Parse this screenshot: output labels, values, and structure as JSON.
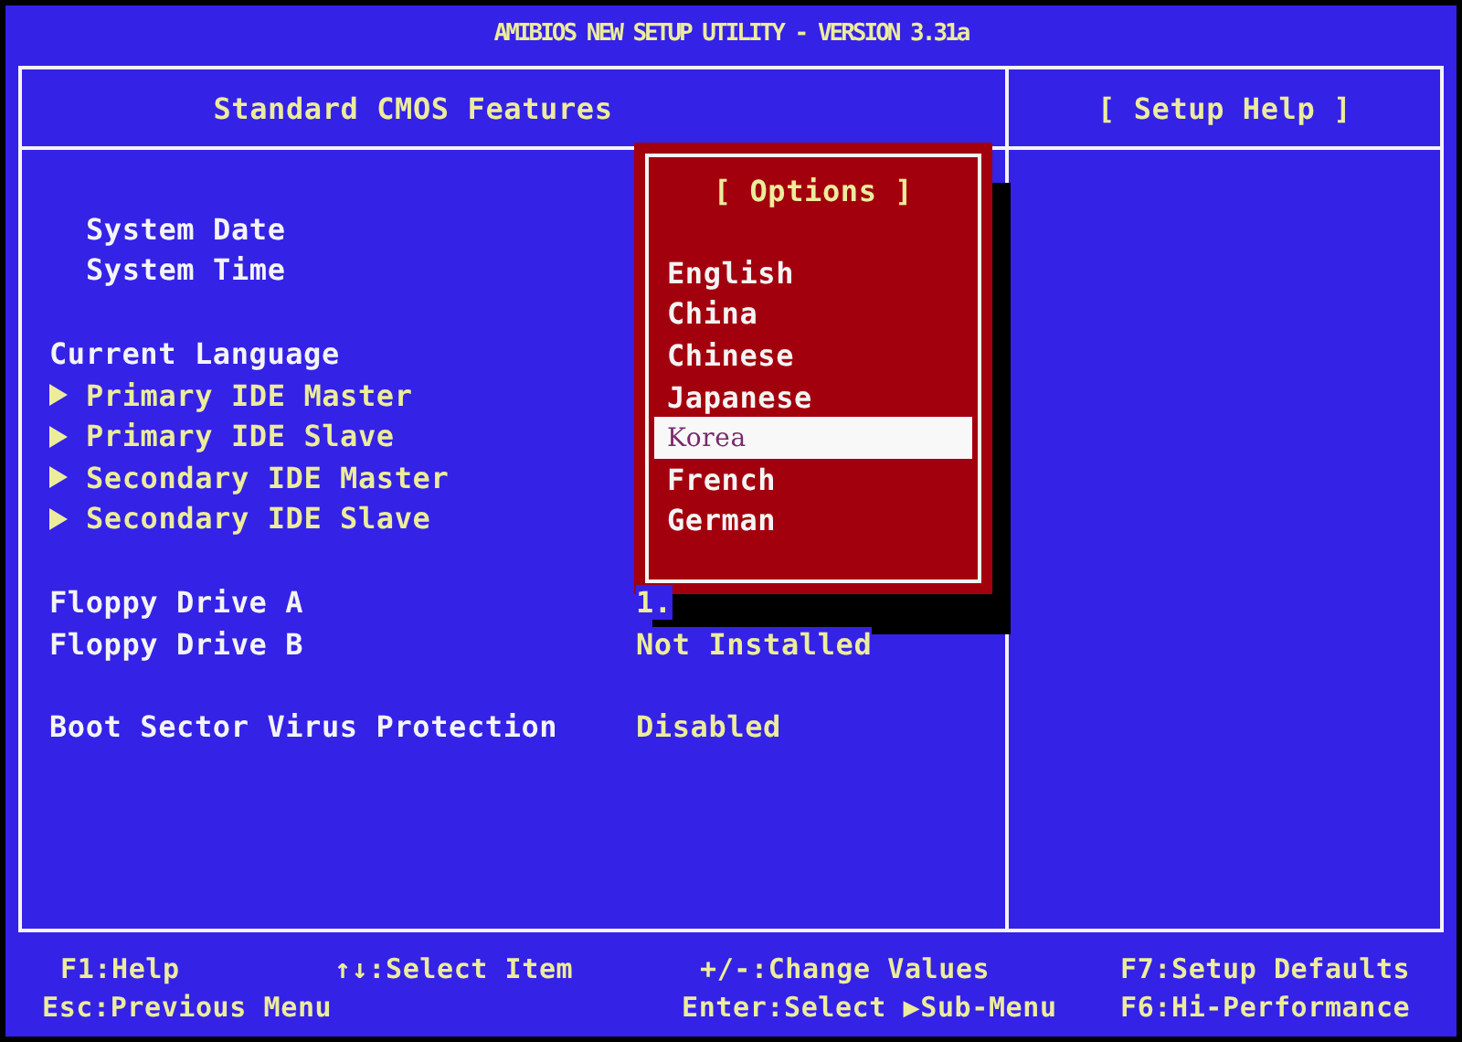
{
  "window": {
    "title": "AMIBIOS NEW SETUP UTILITY - VERSION 3.31a"
  },
  "header": {
    "section": "Standard CMOS Features",
    "help": "[ Setup Help ]"
  },
  "groups": [
    [
      {
        "label": "System Date",
        "kind": "indented"
      },
      {
        "label": "System Time",
        "kind": "indented"
      }
    ],
    [
      {
        "label": "Current Language",
        "kind": "plain"
      },
      {
        "label": "Primary IDE Master",
        "kind": "submenu"
      },
      {
        "label": "Primary IDE Slave",
        "kind": "submenu"
      },
      {
        "label": "Secondary IDE Master",
        "kind": "submenu"
      },
      {
        "label": "Secondary IDE Slave",
        "kind": "submenu"
      }
    ],
    [
      {
        "label": "Floppy Drive A",
        "kind": "plain",
        "value": "1."
      },
      {
        "label": "Floppy Drive B",
        "kind": "plain",
        "value": "Not Installed"
      }
    ],
    [
      {
        "label": "Boot Sector Virus Protection",
        "kind": "plain",
        "value": "Disabled"
      }
    ]
  ],
  "options_popup": {
    "title": "[ Options ]",
    "options": [
      {
        "label": "English",
        "selected": false
      },
      {
        "label": "China",
        "selected": false
      },
      {
        "label": "Chinese",
        "selected": false
      },
      {
        "label": "Japanese",
        "selected": false
      },
      {
        "label": "Korea",
        "selected": true
      },
      {
        "label": "French",
        "selected": false
      },
      {
        "label": "German",
        "selected": false
      }
    ]
  },
  "footer": [
    [
      "F1:Help",
      "↑↓:Select Item",
      "+/-:Change Values",
      "F7:Setup Defaults"
    ],
    [
      "Esc:Previous Menu",
      "Enter:Select ▶Sub-Menu",
      "F6:Hi-Performance"
    ]
  ]
}
